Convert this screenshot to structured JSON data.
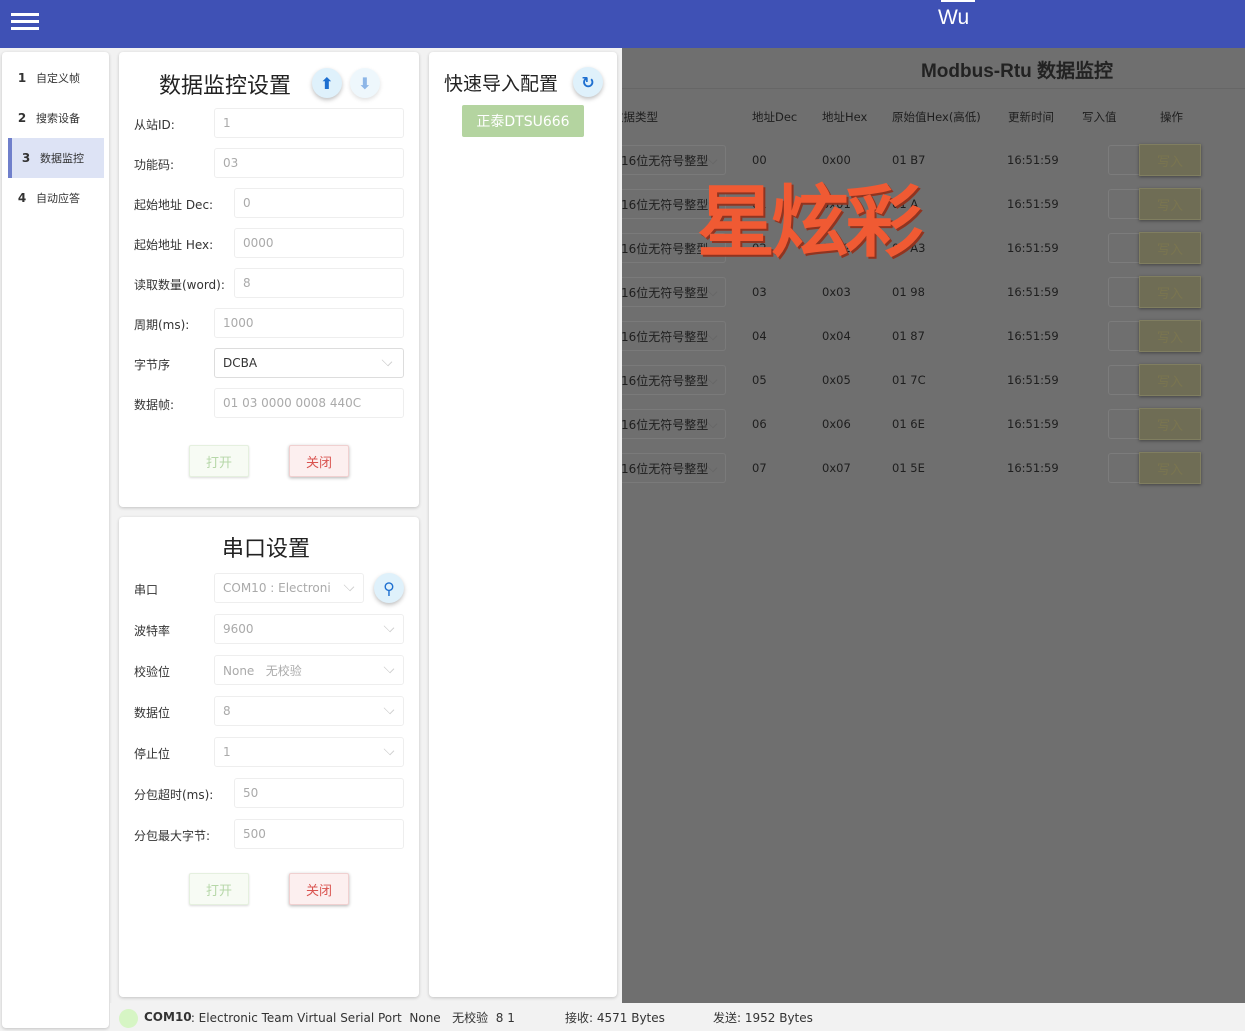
{
  "header": {
    "title": "Wu",
    "menu_icon": "hamburger-icon"
  },
  "nav": [
    {
      "num": "1",
      "label": "自定义帧"
    },
    {
      "num": "2",
      "label": "搜索设备"
    },
    {
      "num": "3",
      "label": "数据监控",
      "active": true
    },
    {
      "num": "4",
      "label": "自动应答"
    }
  ],
  "monitor_settings": {
    "title": "数据监控设置",
    "fields": [
      {
        "label": "从站ID:",
        "value": "1"
      },
      {
        "label": "功能码:",
        "value": "03"
      },
      {
        "label": "起始地址 Dec:",
        "value": "0"
      },
      {
        "label": "起始地址 Hex:",
        "value": "0000"
      },
      {
        "label": "读取数量(word):",
        "value": "8"
      },
      {
        "label": "周期(ms):",
        "value": "1000"
      },
      {
        "label": "字节序",
        "value": "DCBA"
      },
      {
        "label": "数据帧:",
        "value": "01 03 0000 0008 440C"
      }
    ],
    "open": "打开",
    "close": "关闭"
  },
  "serial": {
    "title": "串口设置",
    "fields": [
      {
        "label": "串口",
        "value": "COM10 : Electroni"
      },
      {
        "label": "波特率",
        "value": "9600"
      },
      {
        "label": "校验位",
        "value": "None   无校验"
      },
      {
        "label": "数据位",
        "value": "8"
      },
      {
        "label": "停止位",
        "value": "1"
      },
      {
        "label": "分包超时(ms):",
        "value": "50"
      },
      {
        "label": "分包最大字节:",
        "value": "500"
      }
    ],
    "open": "打开",
    "close": "关闭"
  },
  "quick": {
    "title": "快速导入配置",
    "preset": "正泰DTSU666"
  },
  "table": {
    "title": "Modbus-Rtu 数据监控",
    "headers": [
      "数据类型",
      "地址Dec",
      "地址Hex",
      "原始值Hex(高低)",
      "更新时间",
      "写入值",
      "操作"
    ],
    "rows": [
      {
        "type": "16位无符号整型",
        "dec": "00",
        "hex": "0x00",
        "raw": "01 B7",
        "time": "16:51:59",
        "btn": "写入"
      },
      {
        "type": "16位无符号整型",
        "dec": "01",
        "hex": "0x01",
        "raw": "01 A",
        "time": "16:51:59",
        "btn": "写入"
      },
      {
        "type": "16位无符号整型",
        "dec": "02",
        "hex": "0x02",
        "raw": "01 A3",
        "time": "16:51:59",
        "btn": "写入"
      },
      {
        "type": "16位无符号整型",
        "dec": "03",
        "hex": "0x03",
        "raw": "01 98",
        "time": "16:51:59",
        "btn": "写入"
      },
      {
        "type": "16位无符号整型",
        "dec": "04",
        "hex": "0x04",
        "raw": "01 87",
        "time": "16:51:59",
        "btn": "写入"
      },
      {
        "type": "16位无符号整型",
        "dec": "05",
        "hex": "0x05",
        "raw": "01 7C",
        "time": "16:51:59",
        "btn": "写入"
      },
      {
        "type": "16位无符号整型",
        "dec": "06",
        "hex": "0x06",
        "raw": "01 6E",
        "time": "16:51:59",
        "btn": "写入"
      },
      {
        "type": "16位无符号整型",
        "dec": "07",
        "hex": "0x07",
        "raw": "01 5E",
        "time": "16:51:59",
        "btn": "写入"
      }
    ]
  },
  "watermark": "星炫彩",
  "status": {
    "port": "COM10",
    "desc": " : Electronic Team Virtual Serial Port  None   无校验  8 1",
    "rx": "接收: 4571 Bytes",
    "tx": "发送: 1952 Bytes"
  },
  "colors": {
    "header": "#3f51b5",
    "watermark": "#f05a33",
    "status_dot": "#d6f5c4"
  }
}
